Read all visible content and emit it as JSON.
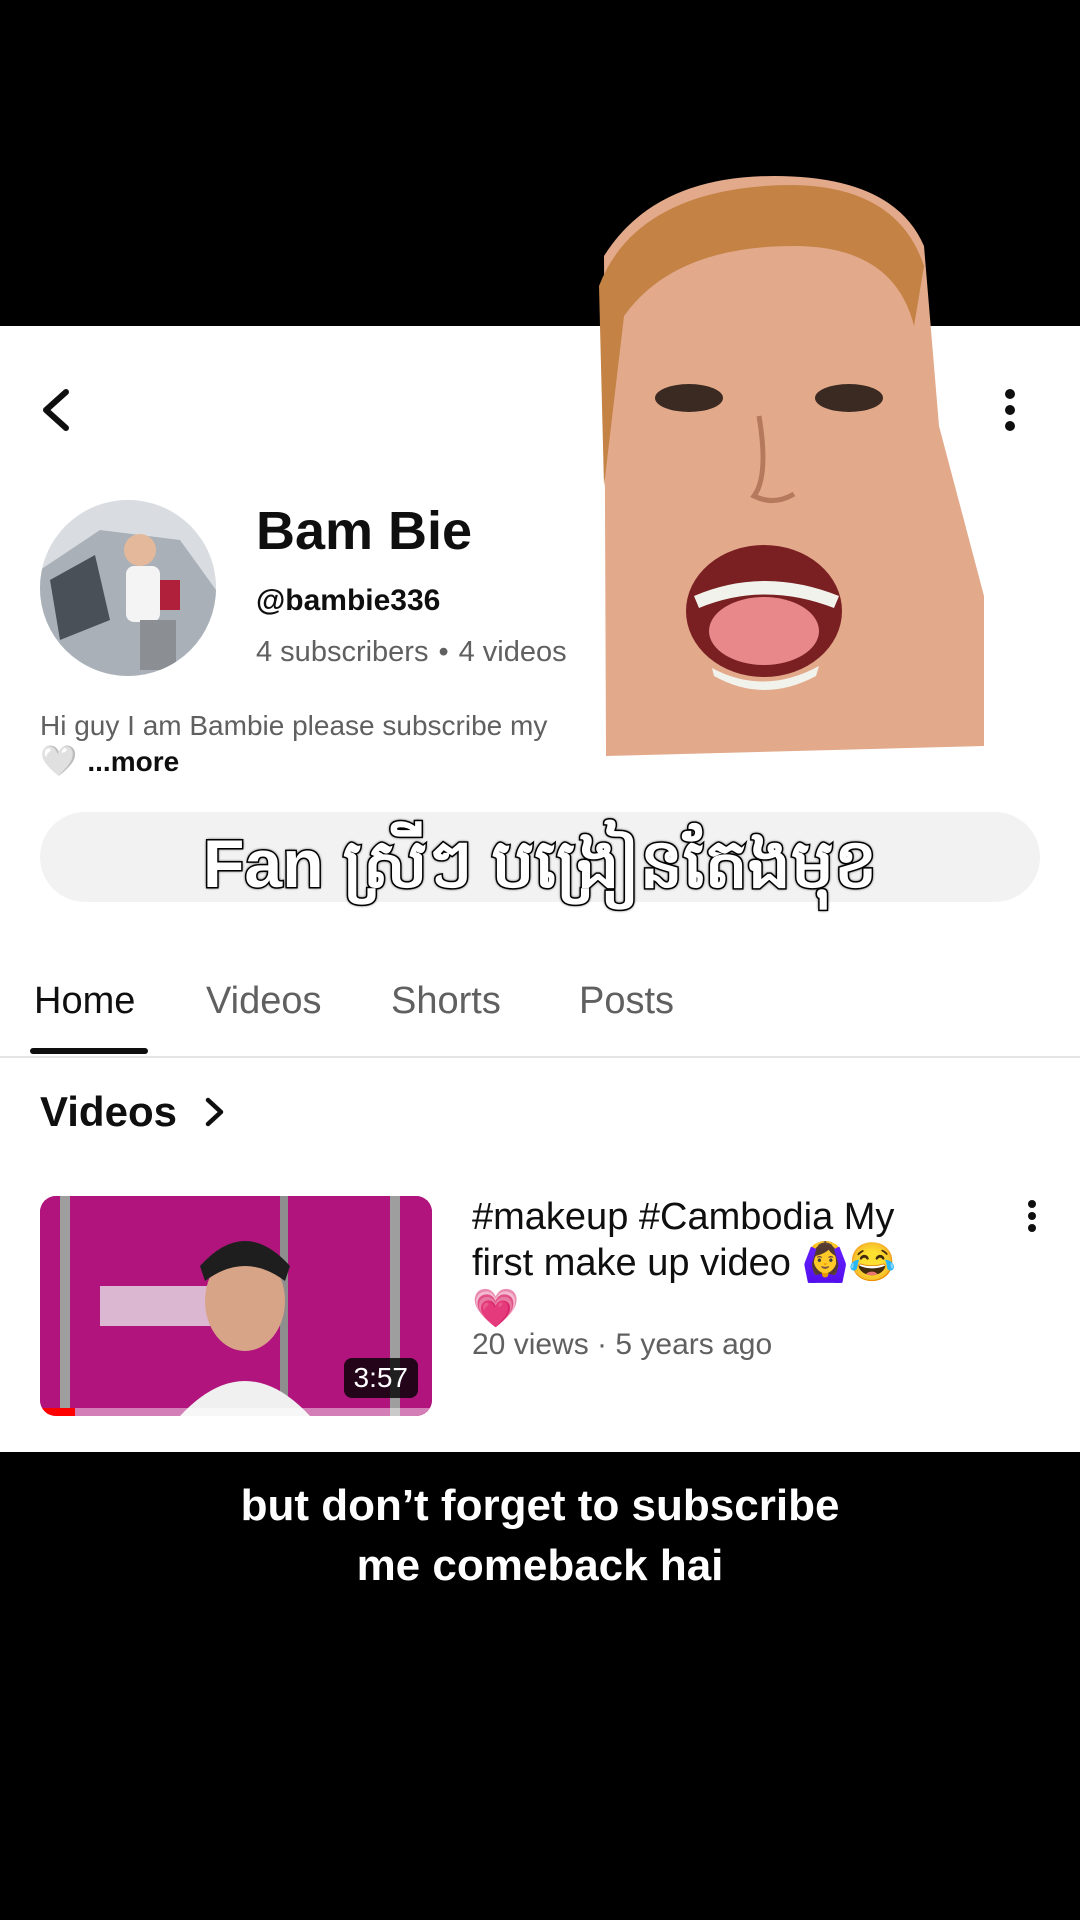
{
  "header": {
    "back_icon": "chevron-left-icon",
    "more_icon": "vertical-dots-icon"
  },
  "channel": {
    "name": "Bam Bie",
    "handle": "@bambie336",
    "subscribers": "4 subscribers",
    "videos_count": "4 videos",
    "description": "Hi guy I am Bambie please subscribe my",
    "more_label": "...more"
  },
  "overlay": {
    "caption": "Fan ស្រីៗ បង្រៀនតែងមុខ"
  },
  "tabs": [
    {
      "label": "Home",
      "active": true
    },
    {
      "label": "Videos",
      "active": false
    },
    {
      "label": "Shorts",
      "active": false
    },
    {
      "label": "Posts",
      "active": false
    }
  ],
  "section": {
    "title": "Videos"
  },
  "video": {
    "title_line1": "#makeup #Cambodia   My",
    "title_line2": "first make up video 🙆‍♀️😂",
    "title_line3": "💗",
    "meta": "20 views · 5 years ago",
    "duration": "3:57",
    "watched_fraction": 0.09
  },
  "subtitle": {
    "line1": "but don’t forget to subscribe",
    "line2": "me comeback hai"
  },
  "colors": {
    "background": "#000000",
    "panel": "#ffffff",
    "thumbnail": "#b1157d",
    "progress": "#ff0000"
  }
}
